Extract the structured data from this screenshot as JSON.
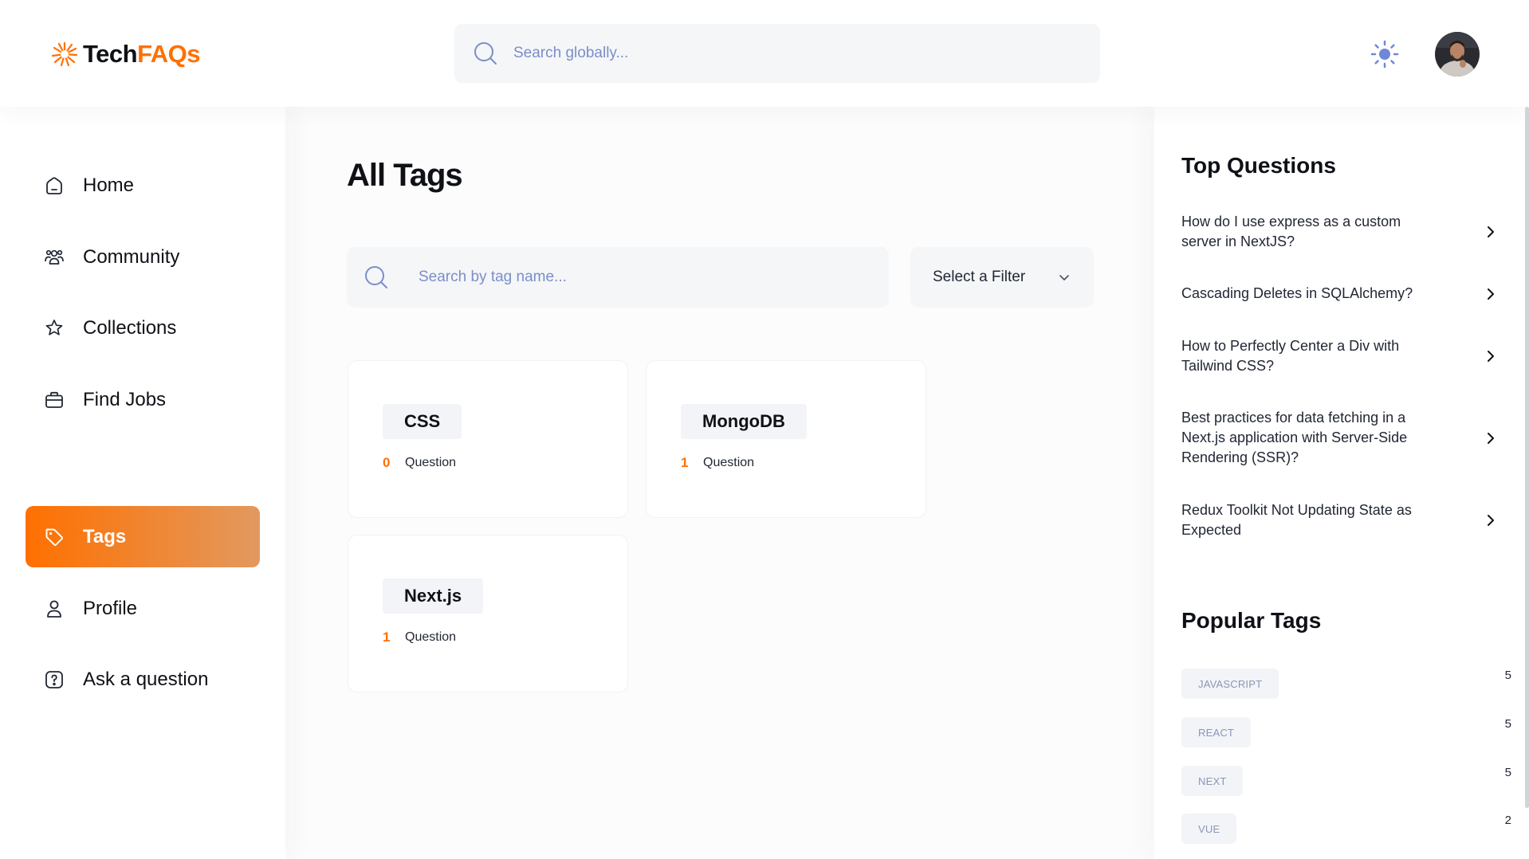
{
  "brand": {
    "part1": "Tech",
    "part2": "FAQs",
    "accent": "#ff7000"
  },
  "header": {
    "search_placeholder": "Search globally...",
    "theme_icon": "sun-icon",
    "avatar_alt": "User avatar"
  },
  "sidebar": {
    "items": [
      {
        "label": "Home",
        "icon": "home-icon"
      },
      {
        "label": "Community",
        "icon": "users-icon"
      },
      {
        "label": "Collections",
        "icon": "star-icon"
      },
      {
        "label": "Find Jobs",
        "icon": "briefcase-icon"
      },
      {
        "label": "Tags",
        "icon": "tag-icon",
        "active": true
      },
      {
        "label": "Profile",
        "icon": "user-icon"
      },
      {
        "label": "Ask a question",
        "icon": "question-icon"
      }
    ]
  },
  "main": {
    "title": "All Tags",
    "search_placeholder": "Search by tag name...",
    "filter_label": "Select a Filter",
    "tags": [
      {
        "name": "CSS",
        "count": "0",
        "label": "Question"
      },
      {
        "name": "MongoDB",
        "count": "1",
        "label": "Question"
      },
      {
        "name": "Next.js",
        "count": "1",
        "label": "Question"
      }
    ]
  },
  "rightbar": {
    "top_questions_title": "Top Questions",
    "questions": [
      "How do I use express as a custom server in NextJS?",
      "Cascading Deletes in SQLAlchemy?",
      "How to Perfectly Center a Div with Tailwind CSS?",
      "Best practices for data fetching in a Next.js application with Server-Side Rendering (SSR)?",
      "Redux Toolkit Not Updating State as Expected"
    ],
    "popular_tags_title": "Popular Tags",
    "popular_tags": [
      {
        "name": "JAVASCRIPT",
        "count": "5"
      },
      {
        "name": "REACT",
        "count": "5"
      },
      {
        "name": "NEXT",
        "count": "5"
      },
      {
        "name": "VUE",
        "count": "2"
      }
    ]
  }
}
